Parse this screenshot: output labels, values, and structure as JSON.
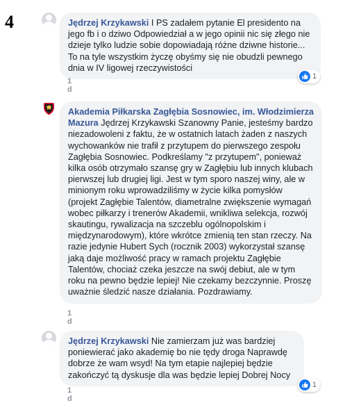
{
  "marker": "4",
  "comments": [
    {
      "author": "Jędrzej Krzykawski",
      "text": "I PS zadałem pytanie El presidento na jego fb i o dziwo Odpowiedział a w jego opinii nic się złego nie dzieje tylko ludzie sobie dopowiadają różne dziwne historie... To na tyle wszystkim życzę obyśmy się nie obudzli pewnego dnia w IV ligowej rzeczywistości",
      "time": "1 d",
      "reactions": "1"
    },
    {
      "author": "Akademia Piłkarska Zagłębia Sosnowiec, im. Włodzimierza Mazura",
      "text": "Jędrzej Krzykawski Szanowny Panie, jesteśmy bardzo niezadowoleni z faktu, że w ostatnich latach żaden z naszych wychowanków nie trafił z przytupem do pierwszego zespołu Zagłębia Sosnowiec. Podkreślamy \"z przytupem\", ponieważ kilka osób otrzymało szansę gry w Zagłębiu lub innych klubach pierwszej lub drugiej ligi. Jest w tym sporo naszej winy, ale w minionym roku wprowadziliśmy w życie kilka pomysłów (projekt Zagłębie Talentów, diametralne zwiększenie wymagań wobec piłkarzy i trenerów Akademii, wnikliwa selekcja, rozwój skautingu, rywalizacja na szczeblu ogólnopolskim i międzynarodowym), które wkrótce zmienią ten stan rzeczy. Na razie jedynie Hubert Sych (rocznik 2003) wykorzystał szansę jaką daje możliwość pracy w ramach projektu Zagłębie Talentów, chociaż czeka jeszcze na swój debiut, ale w tym roku na pewno będzie lepiej! Nie czekamy bezczynnie. Proszę uważnie śledzić nasze działania. Pozdrawiamy.",
      "time": "1 d"
    },
    {
      "author": "Jędrzej Krzykawski",
      "text": "Nie zamierzam już was bardziej poniewierać jako akademię bo nie tędy droga Naprawdę dobrze że wam wsyd! Na tym etapie najlepiej będzie zakończyć tą dyskusje dla was będzie lepiej Dobrej Nocy",
      "time": "1 d",
      "reactions": "1"
    }
  ],
  "colors": {
    "author": "#385898",
    "bubble": "#f2f3f5",
    "text": "#1c1e21",
    "meta": "#90949c",
    "like": "#1877f2"
  }
}
